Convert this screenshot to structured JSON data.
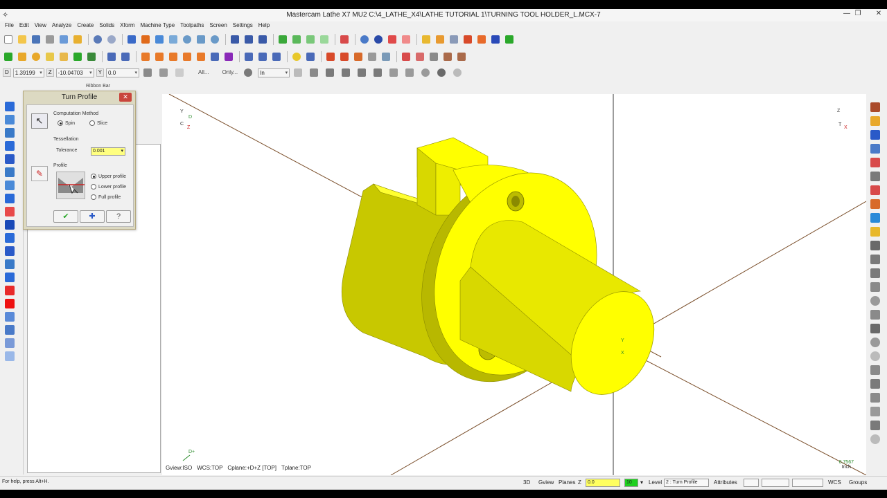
{
  "window": {
    "title": "Mastercam Lathe X7 MU2  C:\\4_LATHE_X4\\LATHE TUTORIAL 1\\TURNING TOOL HOLDER_L.MCX-7",
    "app_icon": "mastercam-icon",
    "minimize": "—",
    "restore": "❐",
    "close": "✕"
  },
  "menu": [
    "File",
    "Edit",
    "View",
    "Analyze",
    "Create",
    "Solids",
    "Xform",
    "Machine Type",
    "Toolpaths",
    "Screen",
    "Settings",
    "Help"
  ],
  "ribbon": {
    "d_label": "D",
    "d_value": "1.39199",
    "z_label": "Z",
    "z_value": "-10.04703",
    "y_label": "Y",
    "y_value": "0.0",
    "all_label": "All...",
    "only_label": "Only...",
    "in_value": "In",
    "caption": "Ribbon Bar"
  },
  "dialog": {
    "title": "Turn Profile",
    "close": "✕",
    "computation_method_label": "Computation Method",
    "spin_label": "Spin",
    "slice_label": "Slice",
    "computation_method_selected": "Spin",
    "tessellation_label": "Tessellation",
    "tolerance_label": "Tolerance",
    "tolerance_value": "0.001",
    "profile_label": "Profile",
    "upper_profile_label": "Upper profile",
    "lower_profile_label": "Lower profile",
    "full_profile_label": "Full profile",
    "profile_selected": "Upper profile",
    "ok_glyph": "✔",
    "apply_glyph": "✚",
    "help_glyph": "?"
  },
  "graphics": {
    "gview": "Gview:ISO",
    "wcs": "WCS:TOP",
    "cplane": "Cplane:+D+Z [TOP]",
    "tplane": "Tplane:TOP",
    "scale_value": "0.7567",
    "scale_unit": "Inch",
    "triad_top_left": [
      "Y",
      "D",
      "C",
      "Z"
    ],
    "triad_top_right": [
      "Z",
      "T",
      "X"
    ],
    "triad_bottom_left": "D+",
    "origin_labels": [
      "Y",
      "X"
    ]
  },
  "status": {
    "help": "For help, press Alt+H.",
    "mode_3d": "3D",
    "gview": "Gview",
    "planes": "Planes",
    "z_label": "Z",
    "z_value": "0.0",
    "color_value": "10",
    "level_label": "Level",
    "level_value": "2 : Turn Profile",
    "attributes": "Attributes",
    "wcs": "WCS",
    "groups": "Groups"
  },
  "colors": {
    "part": "#ffff00",
    "part_shade": "#c8c800",
    "axis_line": "#7a4e2a",
    "triad": "#2a8a2a"
  }
}
